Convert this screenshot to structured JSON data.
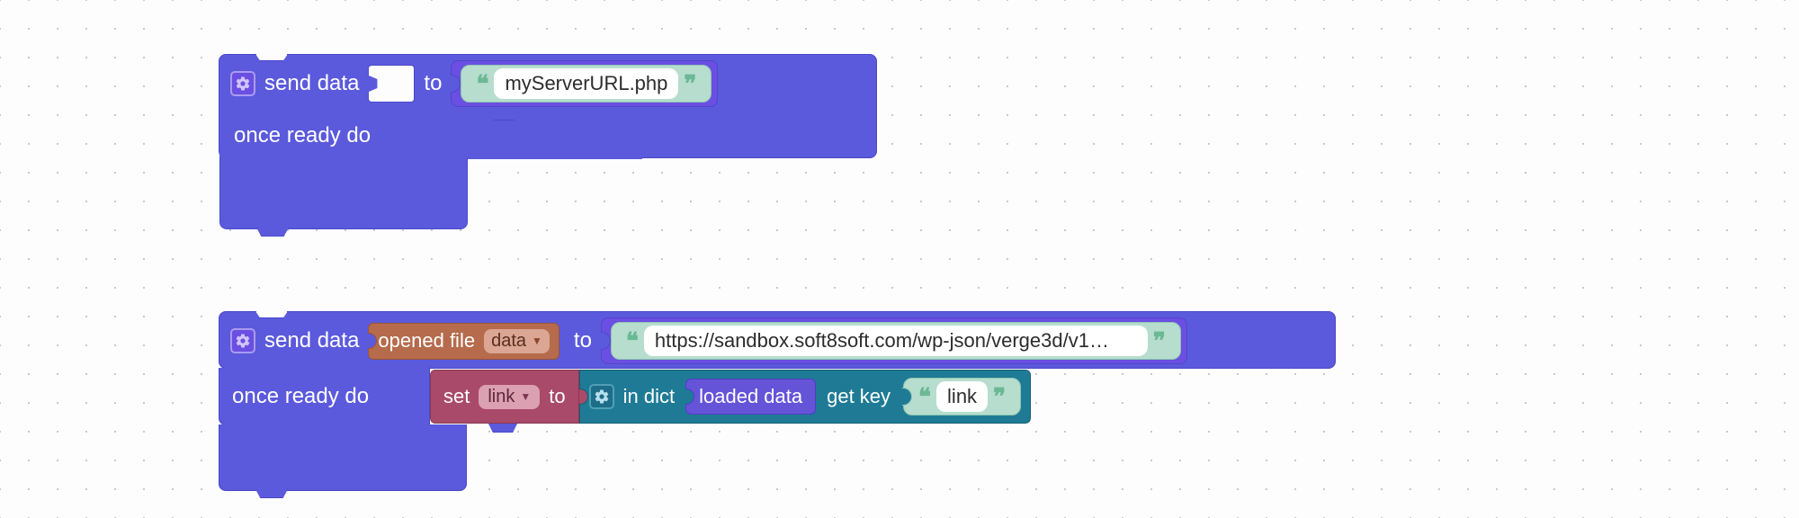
{
  "block1": {
    "label_send_data": "send data",
    "label_to": "to",
    "label_once_ready_do": "once ready do",
    "url": "myServerURL.php"
  },
  "block2": {
    "label_send_data": "send data",
    "label_opened_file": "opened file",
    "data_dropdown": "data",
    "label_to": "to",
    "url": "https://sandbox.soft8soft.com/wp-json/verge3d/v1…",
    "label_once_ready_do": "once ready do",
    "set_label_set": "set",
    "set_var": "link",
    "set_label_to": "to",
    "indict_label": "in dict",
    "indict_var": "loaded data",
    "indict_getkey_label": "get key",
    "indict_key": "link"
  }
}
